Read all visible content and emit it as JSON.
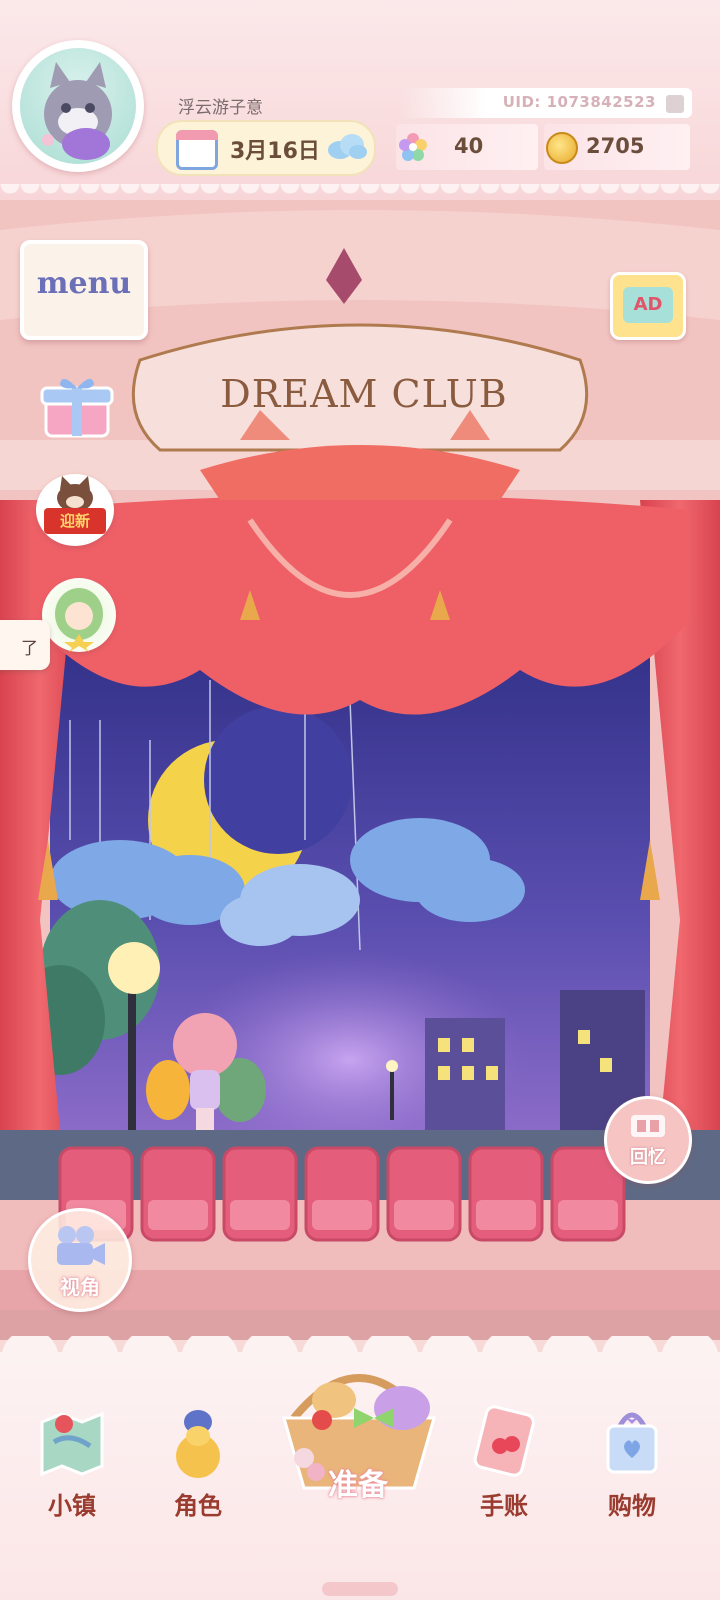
{
  "header": {
    "username": "浮云游子意",
    "uid_label": "UID: 1073842523",
    "date": "3月16日",
    "flower_count": "40",
    "coin_count": "2705"
  },
  "stage": {
    "sign_text": "DREAM CLUB"
  },
  "side_buttons": {
    "menu_label": "menu",
    "newyear_tag": "迎新",
    "toast_text": "了",
    "ad_label": "AD",
    "memory_label": "回忆",
    "camera_label": "视角"
  },
  "bottom_nav": {
    "town": "小镇",
    "character": "角色",
    "prepare": "准备",
    "journal": "手账",
    "shop": "购物"
  },
  "colors": {
    "accent_pink": "#e98a99",
    "label_brown": "#9a3b2f",
    "curtain_red": "#e8525a",
    "night_sky": "#3d3d9a"
  }
}
